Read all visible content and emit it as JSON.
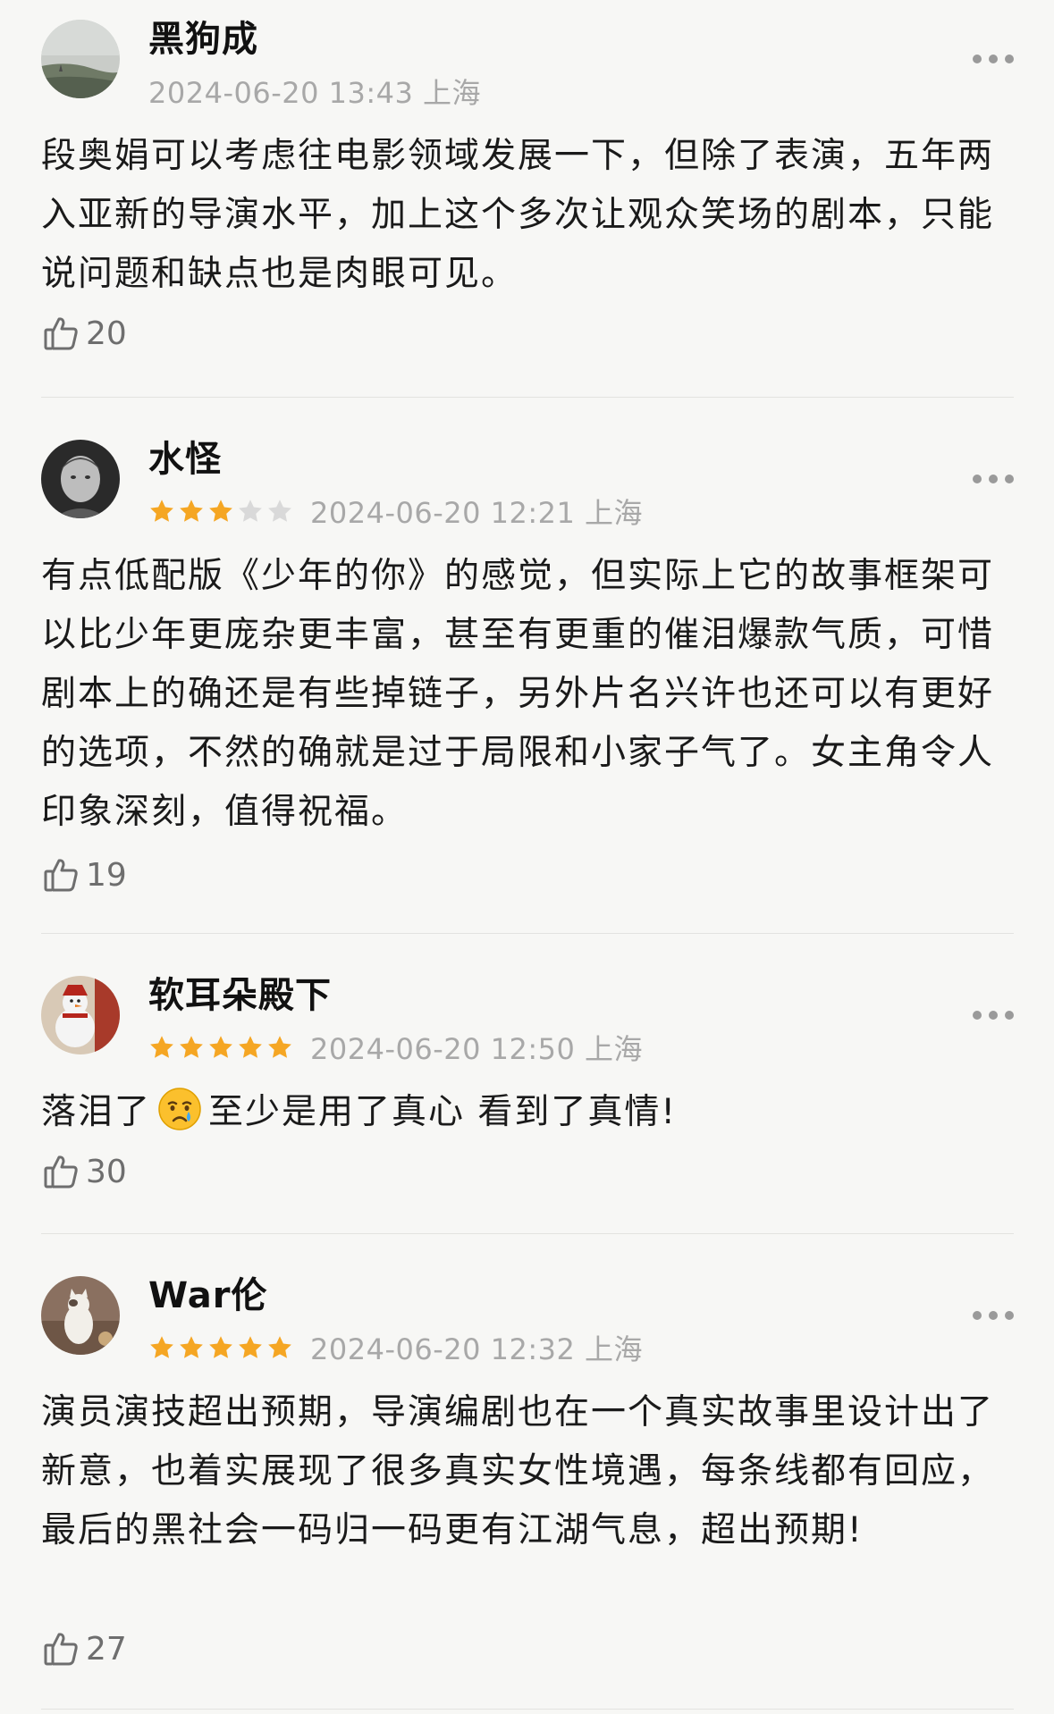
{
  "comments": [
    {
      "username": "黑狗成",
      "timestamp": "2024-06-20 13:43 上海",
      "rating": null,
      "content": "段奥娟可以考虑往电影领域发展一下，但除了表演，五年两入亚新的导演水平，加上这个多次让观众笑场的剧本，只能说问题和缺点也是肉眼可见。",
      "likes": "20"
    },
    {
      "username": "水怪",
      "timestamp": "2024-06-20 12:21 上海",
      "rating": 3,
      "content": "有点低配版《少年的你》的感觉，但实际上它的故事框架可以比少年更庞杂更丰富，甚至有更重的催泪爆款气质，可惜剧本上的确还是有些掉链子，另外片名兴许也还可以有更好的选项，不然的确就是过于局限和小家子气了。女主角令人印象深刻，值得祝福。",
      "likes": "19"
    },
    {
      "username": "软耳朵殿下",
      "timestamp": "2024-06-20 12:50 上海",
      "rating": 5,
      "content_before": "落泪了",
      "content_emoji": "crying-face-emoji",
      "content_after": "至少是用了真心 看到了真情!",
      "likes": "30"
    },
    {
      "username": "War伦",
      "timestamp": "2024-06-20 12:32 上海",
      "rating": 5,
      "content": "演员演技超出预期，导演编剧也在一个真实故事里设计出了新意，也着实展现了很多真实女性境遇，每条线都有回应，最后的黑社会一码归一码更有江湖气息，超出预期!",
      "likes": "27"
    }
  ],
  "icons": {
    "more": "more-dots-icon",
    "like": "thumbs-up-icon",
    "star": "star-icon"
  },
  "colors": {
    "star_on": "#f5a623",
    "star_off": "#d9d9d9",
    "timestamp": "#a8a8a8",
    "background": "#f7f7f5"
  }
}
